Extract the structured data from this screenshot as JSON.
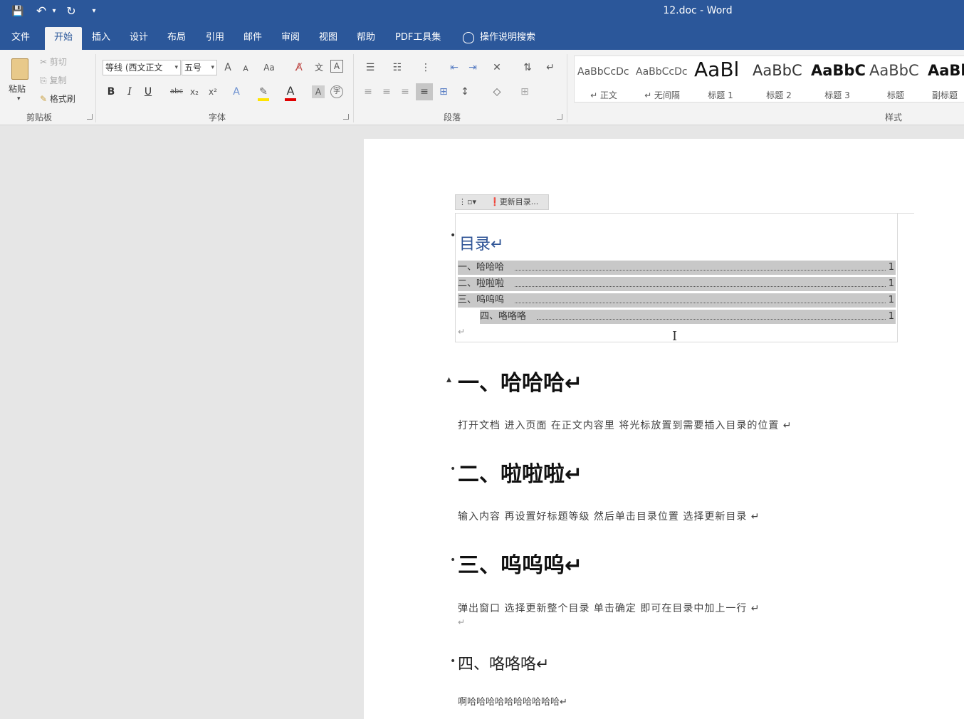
{
  "window": {
    "title": "12.doc  -  Word"
  },
  "qat": {
    "save": "💾",
    "undo": "↶",
    "undo_more": "▾",
    "redo": "↻",
    "customize": "▾"
  },
  "tabs": [
    "文件",
    "开始",
    "插入",
    "设计",
    "布局",
    "引用",
    "邮件",
    "审阅",
    "视图",
    "帮助",
    "PDF工具集"
  ],
  "active_tab": "开始",
  "tell_me": "操作说明搜索",
  "clipboard": {
    "paste": "粘贴",
    "cut": "剪切",
    "copy": "复制",
    "format_painter": "格式刷",
    "label": "剪贴板"
  },
  "font": {
    "font_name": "等线 (西文正文",
    "font_size": "五号",
    "grow": "A",
    "shrink": "A",
    "change_case": "Aa",
    "bold": "B",
    "italic": "I",
    "underline": "U",
    "strike": "abc",
    "subscript": "x₂",
    "superscript": "x²",
    "font_color": "A",
    "char_shading": "A",
    "label": "字体"
  },
  "paragraph": {
    "label": "段落"
  },
  "styles": {
    "label": "样式",
    "items": [
      {
        "sample": "AaBbCcDc",
        "name": "↵ 正文"
      },
      {
        "sample": "AaBbCcDc",
        "name": "↵ 无间隔"
      },
      {
        "sample": "AaBl",
        "name": "标题 1"
      },
      {
        "sample": "AaBbC",
        "name": "标题 2"
      },
      {
        "sample": "AaBbC",
        "name": "标题 3"
      },
      {
        "sample": "AaBbC",
        "name": "标题"
      },
      {
        "sample": "AaBl",
        "name": "副标题"
      }
    ]
  },
  "toc": {
    "update_button": "更新目录...",
    "title": "目录↵",
    "entries": [
      {
        "text": "一、哈哈哈",
        "page": "1"
      },
      {
        "text": "二、啦啦啦",
        "page": "1"
      },
      {
        "text": "三、呜呜呜",
        "page": "1"
      },
      {
        "text": "四、咯咯咯",
        "page": "1"
      }
    ]
  },
  "document": {
    "h1_1": "一、哈哈哈↵",
    "p1": "打开文档   进入页面   在正文内容里   将光标放置到需要插入目录的位置   ↵",
    "h1_2": "二、啦啦啦↵",
    "p2": "输入内容   再设置好标题等级   然后单击目录位置   选择更新目录   ↵",
    "h1_3": "三、呜呜呜↵",
    "p3": "弹出窗口   选择更新整个目录   单击确定   即可在目录中加上一行   ↵",
    "h2_4": "四、咯咯咯↵",
    "p4": "啊哈哈哈哈哈哈哈哈哈哈↵",
    "pilcrow": "↵"
  }
}
